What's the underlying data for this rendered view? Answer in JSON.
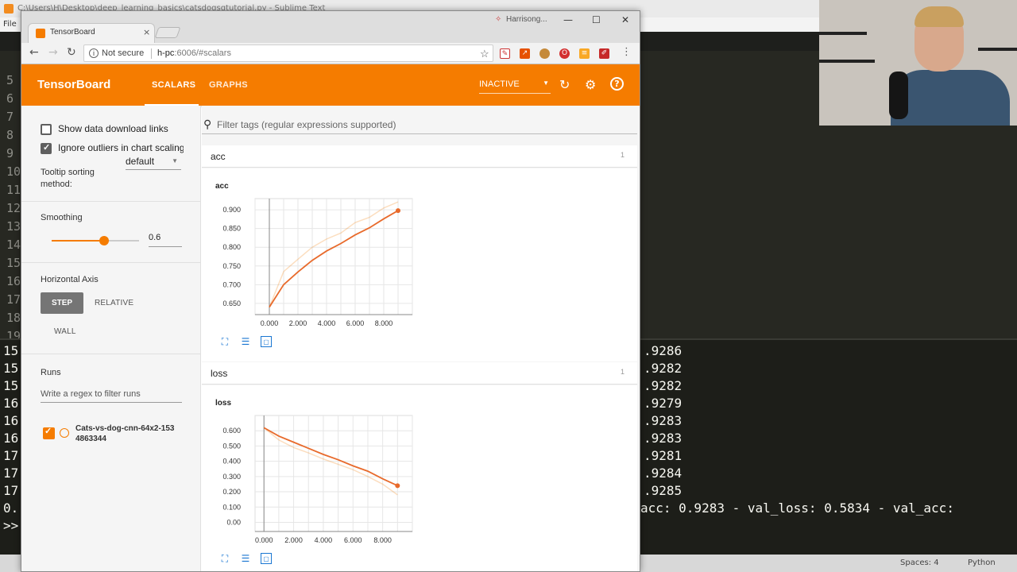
{
  "sublime": {
    "title_text": "C:\\Users\\H\\Desktop\\deep_learning_basics\\catsdogsgtutorial.py - Sublime Text",
    "menu_first": "File",
    "gutter_numbers": [
      "5",
      "6",
      "7",
      "8",
      "9",
      "10",
      "11",
      "12",
      "13",
      "14",
      "15",
      "16",
      "17",
      "18",
      "19"
    ],
    "console_left": [
      "15",
      "15",
      "15",
      "16",
      "16",
      "16",
      "17",
      "17",
      "17",
      "0.",
      ">>"
    ],
    "console_right": [
      ".9286",
      ".9282",
      ".9282",
      ".9279",
      ".9283",
      ".9283",
      ".9281",
      ".9284",
      ".9285"
    ],
    "console_last_line": "acc: 0.9283 - val_loss: 0.5834 - val_acc:",
    "status_spaces": "Spaces: 4",
    "status_syntax": "Python"
  },
  "browser": {
    "tab_title": "TensorBoard",
    "tab_close": "×",
    "profile_name": "Harrisong...",
    "url_info": "i",
    "not_secure": "Not secure",
    "url_host": "h-pc",
    "url_path": ":6006/#scalars",
    "star_icon": "☆",
    "win_min": "—",
    "win_max": "☐",
    "win_close": "✕"
  },
  "tensorboard": {
    "logo": "TensorBoard",
    "tabs": [
      "SCALARS",
      "GRAPHS"
    ],
    "run_status": "INACTIVE",
    "sidebar": {
      "show_download_links": "Show data download links",
      "ignore_outliers": "Ignore outliers in chart scaling",
      "tooltip_sorting_label": "Tooltip sorting method:",
      "tooltip_sorting_value": "default",
      "smoothing_label": "Smoothing",
      "smoothing_value": "0.6",
      "smoothing_fraction": 0.6,
      "horizontal_axis_label": "Horizontal Axis",
      "axis_options": [
        "STEP",
        "RELATIVE",
        "WALL"
      ],
      "runs_label": "Runs",
      "runs_filter_placeholder": "Write a regex to filter runs",
      "run_name": "Cats-vs-dog-cnn-64x2-1534863344"
    },
    "main": {
      "filter_placeholder": "Filter tags (regular expressions supported)",
      "sections": [
        {
          "title": "acc",
          "count": "1",
          "chart_title": "acc"
        },
        {
          "title": "loss",
          "count": "1",
          "chart_title": "loss"
        }
      ]
    }
  },
  "chart_data": [
    {
      "type": "line",
      "title": "acc",
      "xlim": [
        -1.0,
        10.0
      ],
      "ylim": [
        0.62,
        0.93
      ],
      "x_ticks": [
        "0.000",
        "2.000",
        "4.000",
        "6.000",
        "8.000"
      ],
      "y_ticks": [
        "0.650",
        "0.700",
        "0.750",
        "0.800",
        "0.850",
        "0.900"
      ],
      "grid": true,
      "color": "#f57c00",
      "series": [
        {
          "x": [
            0,
            1,
            2,
            3,
            4,
            5,
            6,
            7,
            8,
            9
          ],
          "values": [
            0.64,
            0.7,
            0.734,
            0.765,
            0.79,
            0.81,
            0.833,
            0.852,
            0.876,
            0.898
          ]
        },
        {
          "x": [
            0,
            1,
            2,
            3,
            4,
            5,
            6,
            7,
            8,
            9
          ],
          "values": [
            0.64,
            0.735,
            0.768,
            0.8,
            0.822,
            0.838,
            0.866,
            0.88,
            0.905,
            0.921
          ]
        }
      ]
    },
    {
      "type": "line",
      "title": "loss",
      "xlim": [
        -0.6,
        10.0
      ],
      "ylim": [
        -0.06,
        0.7
      ],
      "x_ticks": [
        "0.000",
        "2.000",
        "4.000",
        "6.000",
        "8.000"
      ],
      "y_ticks": [
        "0.00",
        "0.100",
        "0.200",
        "0.300",
        "0.400",
        "0.500",
        "0.600"
      ],
      "grid": true,
      "color": "#f57c00",
      "series": [
        {
          "x": [
            0,
            1,
            2,
            3,
            4,
            5,
            6,
            7,
            8,
            9
          ],
          "values": [
            0.62,
            0.565,
            0.525,
            0.485,
            0.445,
            0.41,
            0.37,
            0.335,
            0.285,
            0.24
          ]
        },
        {
          "x": [
            0,
            1,
            2,
            3,
            4,
            5,
            6,
            7,
            8,
            9
          ],
          "values": [
            0.62,
            0.54,
            0.49,
            0.455,
            0.415,
            0.38,
            0.345,
            0.3,
            0.25,
            0.18
          ]
        }
      ]
    }
  ]
}
